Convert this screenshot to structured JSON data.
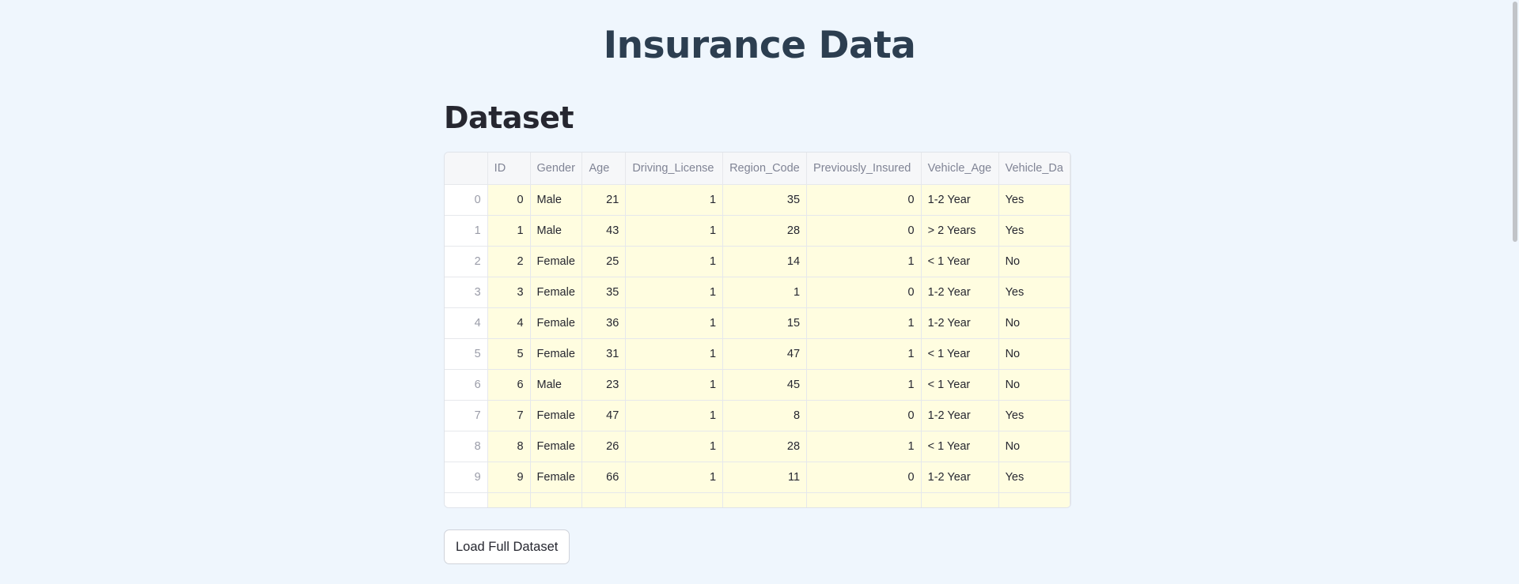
{
  "page": {
    "title": "Insurance Data"
  },
  "section": {
    "title": "Dataset"
  },
  "table": {
    "columns": [
      "",
      "ID",
      "Gender",
      "Age",
      "Driving_License",
      "Region_Code",
      "Previously_Insured",
      "Vehicle_Age",
      "Vehicle_Da"
    ],
    "rows": [
      [
        "0",
        "0",
        "Male",
        "21",
        "1",
        "35",
        "0",
        "1-2 Year",
        "Yes"
      ],
      [
        "1",
        "1",
        "Male",
        "43",
        "1",
        "28",
        "0",
        "> 2 Years",
        "Yes"
      ],
      [
        "2",
        "2",
        "Female",
        "25",
        "1",
        "14",
        "1",
        "< 1 Year",
        "No"
      ],
      [
        "3",
        "3",
        "Female",
        "35",
        "1",
        "1",
        "0",
        "1-2 Year",
        "Yes"
      ],
      [
        "4",
        "4",
        "Female",
        "36",
        "1",
        "15",
        "1",
        "1-2 Year",
        "No"
      ],
      [
        "5",
        "5",
        "Female",
        "31",
        "1",
        "47",
        "1",
        "< 1 Year",
        "No"
      ],
      [
        "6",
        "6",
        "Male",
        "23",
        "1",
        "45",
        "1",
        "< 1 Year",
        "No"
      ],
      [
        "7",
        "7",
        "Female",
        "47",
        "1",
        "8",
        "0",
        "1-2 Year",
        "Yes"
      ],
      [
        "8",
        "8",
        "Female",
        "26",
        "1",
        "28",
        "1",
        "< 1 Year",
        "No"
      ],
      [
        "9",
        "9",
        "Female",
        "66",
        "1",
        "11",
        "0",
        "1-2 Year",
        "Yes"
      ]
    ]
  },
  "buttons": {
    "load_full": "Load Full Dataset"
  },
  "colors": {
    "background": "#eff6fd",
    "cell_highlight": "#fffde0",
    "title": "#2c3e50"
  }
}
